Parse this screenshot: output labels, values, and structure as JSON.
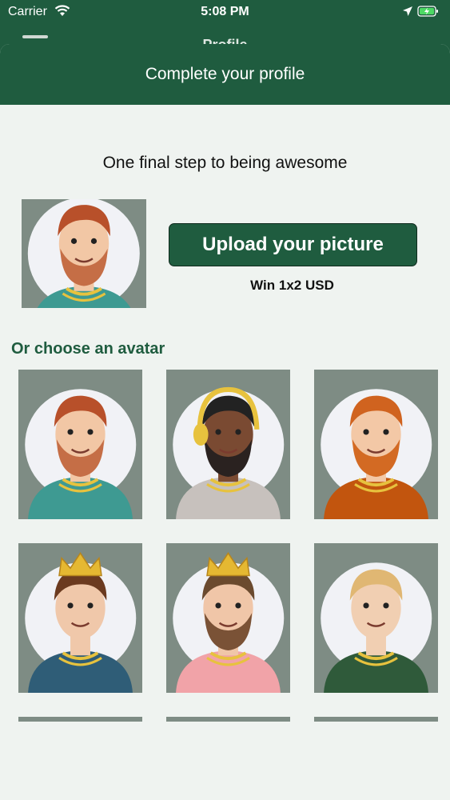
{
  "status_bar": {
    "carrier": "Carrier",
    "time": "5:08 PM"
  },
  "underlying_title": "Profile",
  "sheet": {
    "title": "Complete your profile",
    "tagline": "One final step to being awesome",
    "upload_label": "Upload your picture",
    "reward_text": "Win 1x2 USD",
    "section_title": "Or choose an avatar"
  },
  "avatars": [
    {
      "name": "ginger-man-teal-shirt",
      "skin": "#f2c7a5",
      "hair": "#b8502a",
      "shirt": "#3e9a92",
      "beard": "#c56e46"
    },
    {
      "name": "bearded-man-headphones",
      "skin": "#7a4a32",
      "hair": "#222222",
      "shirt": "#c7c1bd",
      "beard": "#2a2220"
    },
    {
      "name": "red-beard-man",
      "skin": "#f3c8a6",
      "hair": "#d0631f",
      "shirt": "#c2550e",
      "beard": "#d36a23"
    },
    {
      "name": "woman-crown",
      "skin": "#f0c8aa",
      "hair": "#6b3a1f",
      "shirt": "#2f5d77",
      "beard": null
    },
    {
      "name": "king-beard-man",
      "skin": "#f0c6a8",
      "hair": "#6b4a2e",
      "shirt": "#f1a3a8",
      "beard": "#7a5236"
    },
    {
      "name": "blond-man-green-shirt",
      "skin": "#f1cfb2",
      "hair": "#e0b773",
      "shirt": "#2f5a3a",
      "beard": null
    }
  ]
}
